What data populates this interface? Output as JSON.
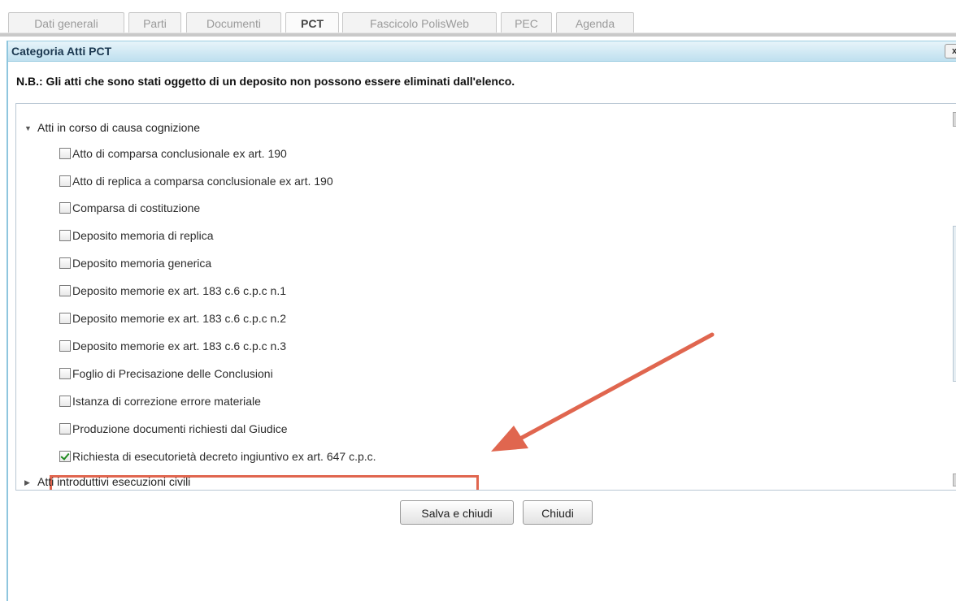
{
  "tabs": [
    {
      "label": "Dati generali",
      "active": false
    },
    {
      "label": "Parti",
      "active": false
    },
    {
      "label": "Documenti",
      "active": false
    },
    {
      "label": "PCT",
      "active": true
    },
    {
      "label": "Fascicolo PolisWeb",
      "active": false
    },
    {
      "label": "PEC",
      "active": false
    },
    {
      "label": "Agenda",
      "active": false
    }
  ],
  "dialog": {
    "title": "Categoria Atti PCT",
    "close_label": "x",
    "notice": "N.B.: Gli atti che sono stati oggetto di un deposito non possono essere eliminati dall'elenco."
  },
  "tree": {
    "groups": [
      {
        "label": "Atti in corso di causa cognizione",
        "expanded": true
      },
      {
        "label": "Atti introduttivi esecuzioni civili",
        "expanded": false
      }
    ],
    "items": [
      {
        "label": "Atto di comparsa conclusionale ex art. 190",
        "checked": false
      },
      {
        "label": "Atto di replica a comparsa conclusionale ex art. 190",
        "checked": false
      },
      {
        "label": "Comparsa di costituzione",
        "checked": false
      },
      {
        "label": "Deposito memoria di replica",
        "checked": false
      },
      {
        "label": "Deposito memoria generica",
        "checked": false
      },
      {
        "label": "Deposito memorie ex art. 183 c.6 c.p.c n.1",
        "checked": false
      },
      {
        "label": "Deposito memorie ex art. 183 c.6 c.p.c n.2",
        "checked": false
      },
      {
        "label": "Deposito memorie ex art. 183 c.6 c.p.c n.3",
        "checked": false
      },
      {
        "label": "Foglio di Precisazione delle Conclusioni",
        "checked": false
      },
      {
        "label": "Istanza di correzione errore materiale",
        "checked": false
      },
      {
        "label": "Produzione documenti richiesti dal Giudice",
        "checked": false
      },
      {
        "label": "Richiesta di esecutorietà decreto ingiuntivo ex art. 647 c.p.c.",
        "checked": true
      }
    ]
  },
  "buttons": {
    "save_close": "Salva e chiudi",
    "close": "Chiudi"
  },
  "colors": {
    "annotation": "#e0664f",
    "checkmark": "#1f8a1f",
    "titlebar": "#bfe0ef"
  }
}
